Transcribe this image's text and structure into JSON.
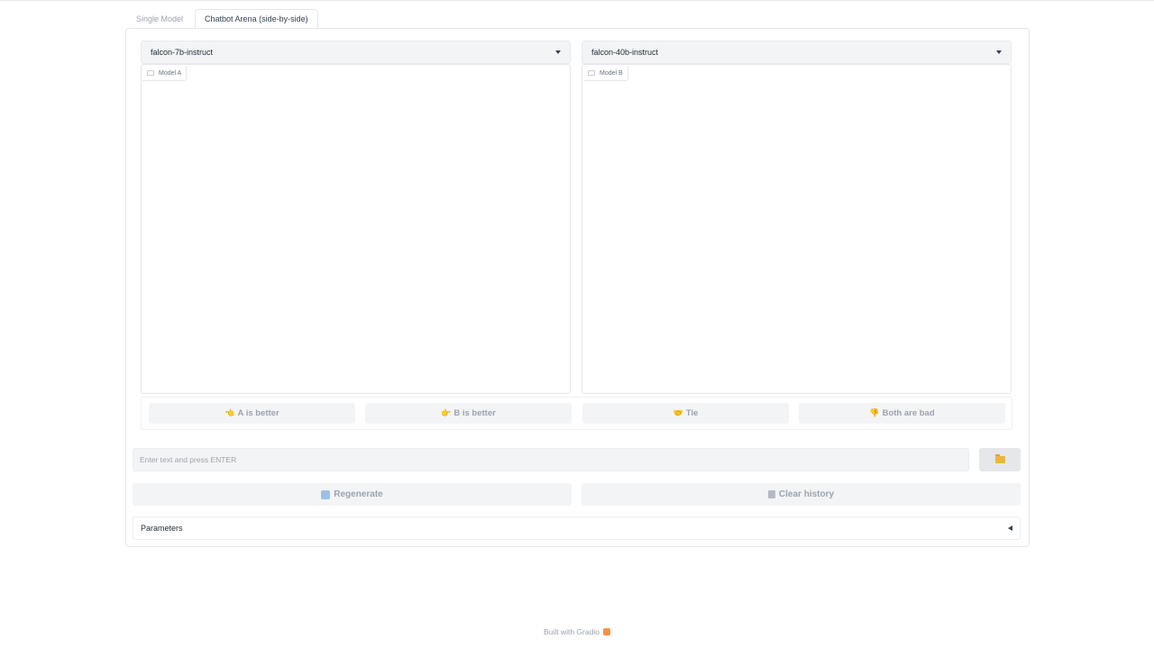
{
  "tabs": [
    {
      "label": "Single Model",
      "active": false
    },
    {
      "label": "Chatbot Arena (side-by-side)",
      "active": true
    }
  ],
  "model_a": {
    "selected": "falcon-7b-instruct",
    "chat_label": "Model A"
  },
  "model_b": {
    "selected": "falcon-40b-instruct",
    "chat_label": "Model B"
  },
  "vote_buttons": [
    {
      "emoji": "👈",
      "label": "A is better"
    },
    {
      "emoji": "👉",
      "label": "B is better"
    },
    {
      "emoji": "🤝",
      "label": "Tie"
    },
    {
      "emoji": "👎",
      "label": "Both are bad"
    }
  ],
  "input": {
    "placeholder": "Enter text and press ENTER"
  },
  "actions": {
    "regenerate_label": "Regenerate",
    "clear_label": "Clear history"
  },
  "parameters": {
    "label": "Parameters"
  },
  "footer": {
    "text": "Built with Gradio"
  },
  "colors": {
    "button_bg": "#f3f4f6",
    "disabled_text": "#9ca3af",
    "border": "#e5e7eb"
  }
}
